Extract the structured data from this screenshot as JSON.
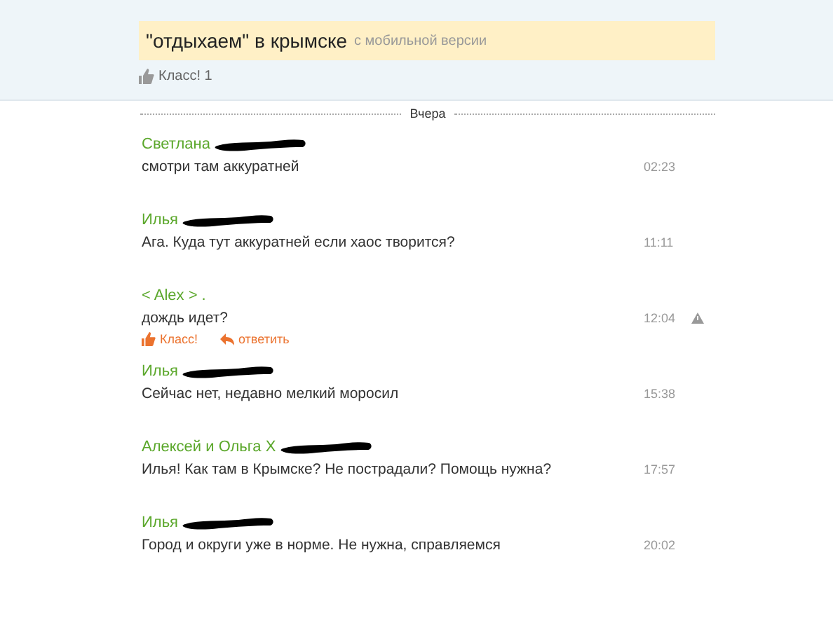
{
  "topic": {
    "title": "\"отдыхаем\" в крымске",
    "source": "с мобильной версии"
  },
  "likes": {
    "label": "Класс! 1"
  },
  "day_divider": "Вчера",
  "comments": [
    {
      "author": "Светлана",
      "redacted": true,
      "text": "смотри там аккуратней",
      "time": "02:23",
      "warning": false
    },
    {
      "author": "Илья",
      "redacted": true,
      "text": "Ага. Куда тут аккуратней если хаос творится?",
      "time": "11:11",
      "warning": false
    },
    {
      "author": "< Alex > .",
      "redacted": false,
      "text": "дождь идет?",
      "time": "12:04",
      "warning": true,
      "actions": [
        {
          "kind": "like",
          "label": "Класс!"
        },
        {
          "kind": "reply",
          "label": "ответить"
        }
      ]
    },
    {
      "author": "Илья",
      "redacted": true,
      "text": "Сейчас нет, недавно мелкий моросил",
      "time": "15:38",
      "warning": false
    },
    {
      "author": "Алексей и Ольга Х",
      "redacted": true,
      "text": "Илья! Как там в Крымске? Не пострадали? Помощь нужна?",
      "time": "17:57",
      "warning": false
    },
    {
      "author": "Илья",
      "redacted": true,
      "text": "Город и округи уже в норме. Не нужна, справляемся",
      "time": "20:02",
      "warning": false
    }
  ]
}
